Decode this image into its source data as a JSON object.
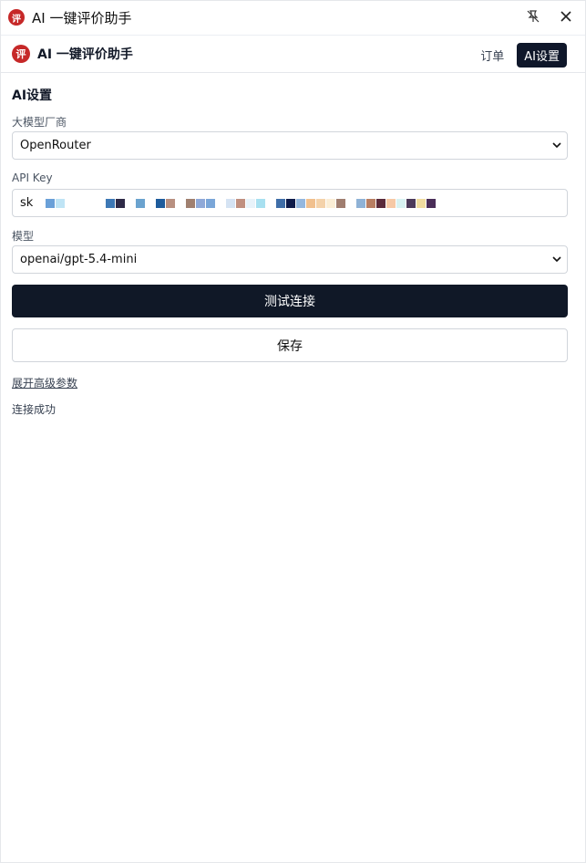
{
  "window": {
    "logo_text": "评",
    "title": "AI 一键评价助手"
  },
  "header": {
    "logo_text": "评",
    "title": "AI 一键评价助手",
    "tabs": [
      {
        "label": "订单",
        "active": false
      },
      {
        "label": "AI设置",
        "active": true
      }
    ]
  },
  "settings": {
    "section_title": "AI设置",
    "provider_label": "大模型厂商",
    "provider_value": "OpenRouter",
    "api_key_label": "API Key",
    "api_key_value": "sk",
    "model_label": "模型",
    "model_value": "openai/gpt-5.4-mini",
    "test_button": "测试连接",
    "save_button": "保存",
    "advanced_link": "展开高级参数",
    "status_text": "连接成功"
  },
  "colors": {
    "accent": "#101827",
    "logo": "#c62828"
  },
  "icons": [
    "unpin-icon",
    "close-icon",
    "chevron-down-icon"
  ]
}
